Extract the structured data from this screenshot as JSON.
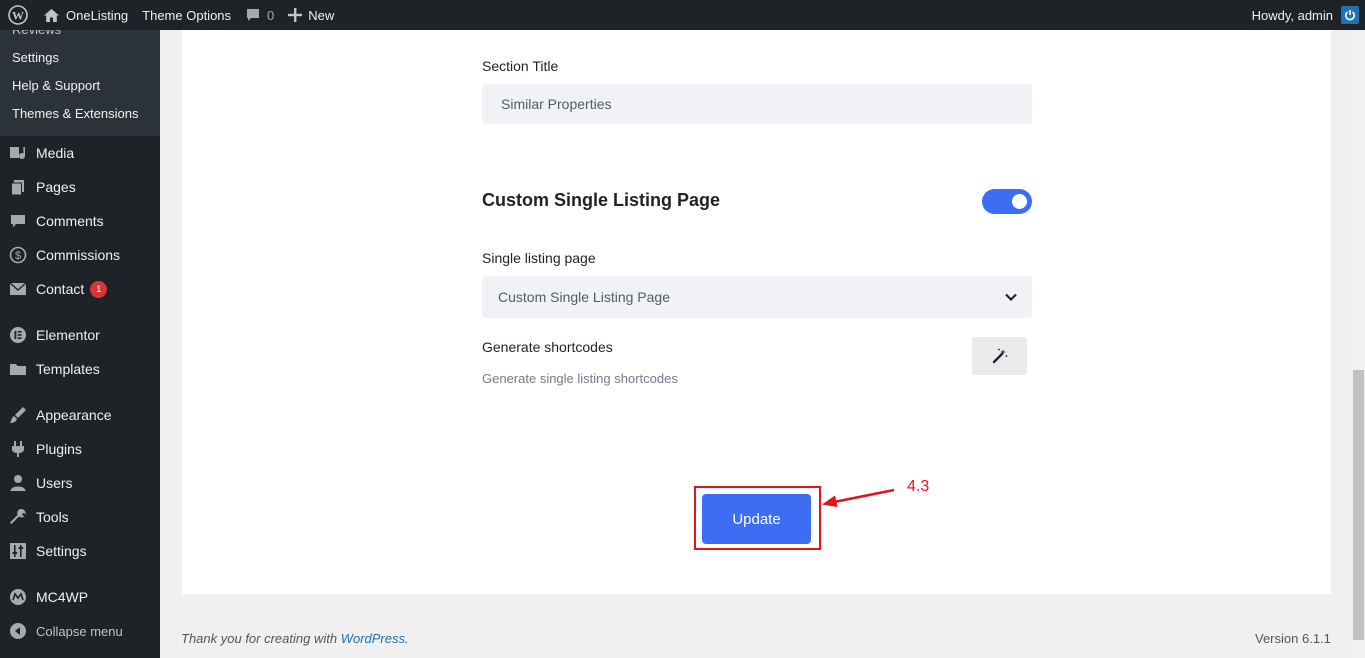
{
  "admin_bar": {
    "site_name": "OneListing",
    "theme_options": "Theme Options",
    "comments_count": "0",
    "new_label": "New",
    "howdy": "Howdy, admin"
  },
  "sidebar": {
    "submenu": {
      "cut_item": "Reviews",
      "items": [
        "Settings",
        "Help & Support",
        "Themes & Extensions"
      ]
    },
    "menu": {
      "media": "Media",
      "pages": "Pages",
      "comments": "Comments",
      "commissions": "Commissions",
      "contact": "Contact",
      "contact_badge": "1",
      "elementor": "Elementor",
      "templates": "Templates",
      "appearance": "Appearance",
      "plugins": "Plugins",
      "users": "Users",
      "tools": "Tools",
      "settings": "Settings",
      "mc4wp": "MC4WP",
      "collapse": "Collapse menu"
    }
  },
  "main": {
    "section_title_label": "Section Title",
    "section_title_value": "Similar Properties",
    "custom_single_heading": "Custom Single Listing Page",
    "custom_single_enabled": true,
    "single_listing_label": "Single listing page",
    "single_listing_selected": "Custom Single Listing Page",
    "generate_label": "Generate shortcodes",
    "generate_desc": "Generate single listing shortcodes",
    "update_button": "Update",
    "annotation": "4.3"
  },
  "footer": {
    "thanks_prefix": "Thank you for creating with",
    "wordpress_link": "WordPress",
    "thanks_suffix": ".",
    "version": "Version 6.1.1"
  },
  "colors": {
    "primary": "#3d6df3",
    "annotation": "#e3131c",
    "admin_bg": "#1d2327"
  }
}
